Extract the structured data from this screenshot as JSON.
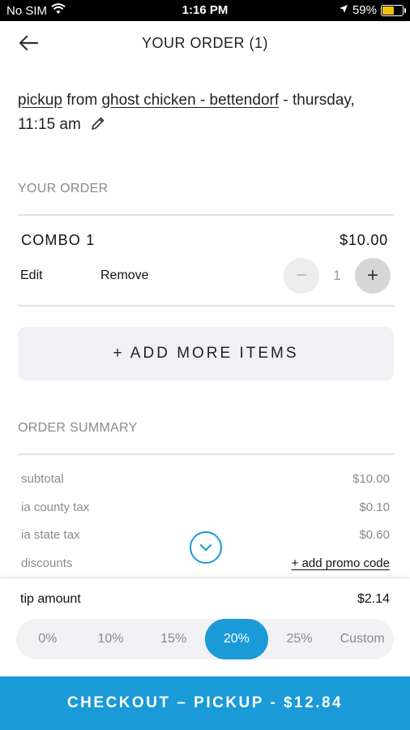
{
  "status_bar": {
    "carrier": "No SIM",
    "time": "1:16 PM",
    "battery": "59%",
    "battery_level": 0.59
  },
  "header": {
    "title": "YOUR ORDER (1)"
  },
  "pickup": {
    "mode": "pickup",
    "from_text": " from ",
    "location": "ghost chicken - bettendorf",
    "when": " - thursday, 11:15 am"
  },
  "order": {
    "section_label": "YOUR ORDER",
    "item": {
      "name": "COMBO 1",
      "price": "$10.00",
      "edit_label": "Edit",
      "remove_label": "Remove",
      "quantity": "1",
      "minus": "−",
      "plus": "+"
    },
    "add_more_label": "+ ADD MORE ITEMS"
  },
  "summary": {
    "section_label": "ORDER SUMMARY",
    "rows": [
      {
        "label": "subtotal",
        "value": "$10.00"
      },
      {
        "label": "ia county tax",
        "value": "$0.10"
      },
      {
        "label": "ia state tax",
        "value": "$0.60"
      },
      {
        "label": "discounts",
        "value": "+ add promo code"
      }
    ]
  },
  "tip": {
    "label": "tip amount",
    "amount": "$2.14",
    "options": [
      "0%",
      "10%",
      "15%",
      "20%",
      "25%",
      "Custom"
    ],
    "selected": "20%"
  },
  "checkout": {
    "label": "CHECKOUT – PICKUP - $12.84"
  },
  "colors": {
    "accent": "#1a9ad6",
    "battery": "#f4c20d"
  }
}
